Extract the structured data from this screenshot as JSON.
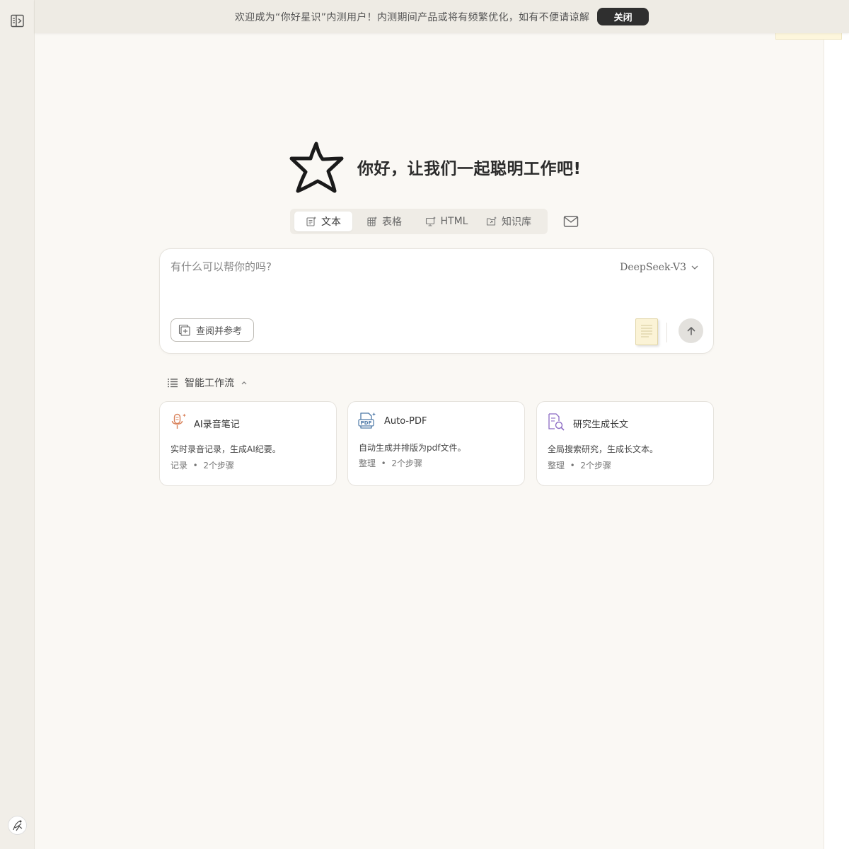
{
  "banner": {
    "message": "欢迎成为“你好星识”内测用户！内测期间产品或将有频繁优化，如有不便请谅解",
    "close_label": "关闭"
  },
  "hero": {
    "title": "你好，让我们一起聪明工作吧!"
  },
  "mode_tabs": [
    {
      "label": "文本",
      "icon": "text-doc-icon",
      "active": true
    },
    {
      "label": "表格",
      "icon": "table-icon",
      "active": false
    },
    {
      "label": "HTML",
      "icon": "html-monitor-icon",
      "active": false
    },
    {
      "label": "知识库",
      "icon": "folder-share-icon",
      "active": false
    }
  ],
  "composer": {
    "placeholder": "有什么可以帮你的吗?",
    "model": "DeepSeek-V3",
    "reference_label": "查阅并参考"
  },
  "workflow": {
    "title": "智能工作流",
    "cards": [
      {
        "icon": "microphone-icon",
        "title": "AI录音笔记",
        "desc": "实时录音记录，生成AI纪要。",
        "tag": "记录",
        "steps": "2个步骤"
      },
      {
        "icon": "pdf-icon",
        "title": "Auto-PDF",
        "desc": "自动生成并排版为pdf文件。",
        "tag": "整理",
        "steps": "2个步骤"
      },
      {
        "icon": "doc-search-icon",
        "title": "研究生成长文",
        "desc": "全局搜索研究，生成长文本。",
        "tag": "整理",
        "steps": "2个步骤"
      }
    ]
  },
  "colors": {
    "background": "#faf8f4",
    "sidebar": "#f1eee8",
    "banner": "#eeebe4",
    "close_button": "#2f2f2f",
    "mic_accent": "#d9825b",
    "pdf_accent": "#4f7aa8",
    "research_accent": "#8c6bc4"
  }
}
